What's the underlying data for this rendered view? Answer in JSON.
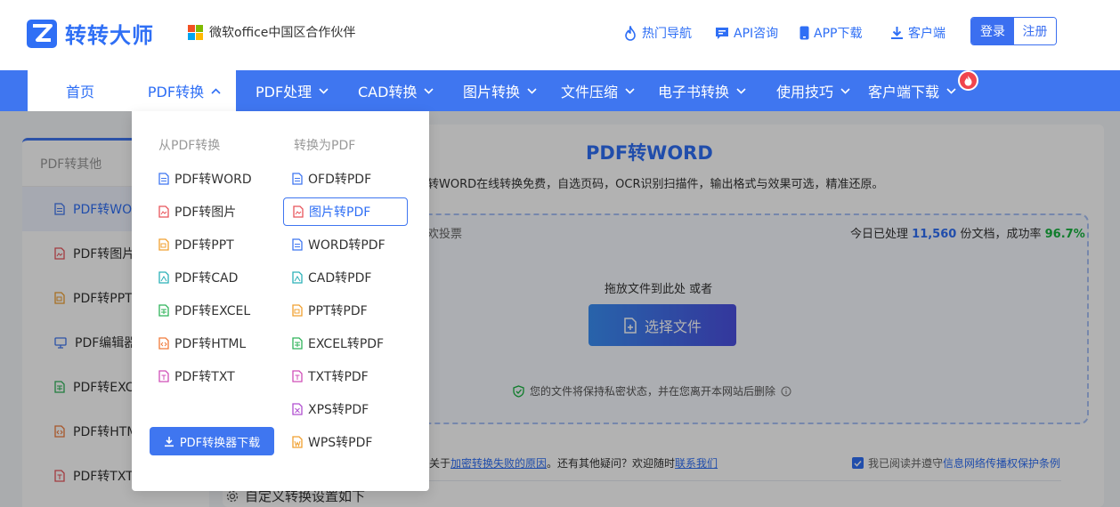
{
  "header": {
    "logo_text": "转转大师",
    "partner_text": "微软office中国区合作伙伴",
    "links": [
      {
        "label": "热门导航",
        "icon": "fire-icon"
      },
      {
        "label": "API咨询",
        "icon": "chat-icon"
      },
      {
        "label": "APP下载",
        "icon": "phone-icon"
      },
      {
        "label": "客户端",
        "icon": "download-icon"
      }
    ],
    "login_label": "登录",
    "register_label": "注册"
  },
  "nav": {
    "items": [
      {
        "label": "首页"
      },
      {
        "label": "PDF转换"
      },
      {
        "label": "PDF处理"
      },
      {
        "label": "CAD转换"
      },
      {
        "label": "图片转换"
      },
      {
        "label": "文件压缩"
      },
      {
        "label": "电子书转换"
      },
      {
        "label": "使用技巧"
      },
      {
        "label": "客户端下载"
      }
    ]
  },
  "dropdown": {
    "col1_heading": "从PDF转换",
    "col2_heading": "转换为PDF",
    "from_pdf": [
      {
        "label": "PDF转WORD",
        "color": "#3f76f0"
      },
      {
        "label": "PDF转图片",
        "color": "#e8545b"
      },
      {
        "label": "PDF转PPT",
        "color": "#f0a030"
      },
      {
        "label": "PDF转CAD",
        "color": "#2bb0b8"
      },
      {
        "label": "PDF转EXCEL",
        "color": "#2fb35a"
      },
      {
        "label": "PDF转HTML",
        "color": "#f07a3a"
      },
      {
        "label": "PDF转TXT",
        "color": "#d04fb8"
      }
    ],
    "to_pdf": [
      {
        "label": "OFD转PDF",
        "color": "#3f76f0"
      },
      {
        "label": "图片转PDF",
        "color": "#e8545b"
      },
      {
        "label": "WORD转PDF",
        "color": "#3f76f0"
      },
      {
        "label": "CAD转PDF",
        "color": "#2bb0b8"
      },
      {
        "label": "PPT转PDF",
        "color": "#f0a030"
      },
      {
        "label": "EXCEL转PDF",
        "color": "#2fb35a"
      },
      {
        "label": "TXT转PDF",
        "color": "#d04fb8"
      },
      {
        "label": "XPS转PDF",
        "color": "#b04fd0"
      },
      {
        "label": "WPS转PDF",
        "color": "#f0a030"
      }
    ],
    "download_button": "PDF转换器下载"
  },
  "sidebar": {
    "heading": "PDF转其他",
    "items": [
      {
        "label": "PDF转WO",
        "color": "#3f76f0"
      },
      {
        "label": "PDF转图片",
        "color": "#e8545b"
      },
      {
        "label": "PDF转PPT",
        "color": "#f0a030"
      },
      {
        "label": "PDF编辑器",
        "color": "#3f76f0"
      },
      {
        "label": "PDF转EXC",
        "color": "#2fb35a"
      },
      {
        "label": "PDF转HTM",
        "color": "#f07a3a"
      },
      {
        "label": "PDF转TXT",
        "color": "#e8545b"
      }
    ]
  },
  "main": {
    "title": "PDF转WORD",
    "subtitle": "转WORD在线转换免费，自选页码，OCR识别扫描件，输出格式与效果可选，精准还原。",
    "vote": "欢投票",
    "stats_prefix": "今日已处理",
    "stats_count": "11,560",
    "stats_mid": "份文档，成功率",
    "stats_rate": "96.7%",
    "drop_hint": "拖放文件到此处 或者",
    "choose_button": "选择文件",
    "privacy": "您的文件将保持私密状态，并在您离开本网站后删除",
    "help_prefix": "关于",
    "help_link1": "加密转换失败的原因",
    "help_mid": "。还有其他疑问？欢迎随时",
    "help_link2": "联系我们",
    "agree_text": "我已阅读并遵守",
    "agree_link": "信息网络传播权保护条例",
    "custom_settings": "自定义转换设置如下"
  }
}
